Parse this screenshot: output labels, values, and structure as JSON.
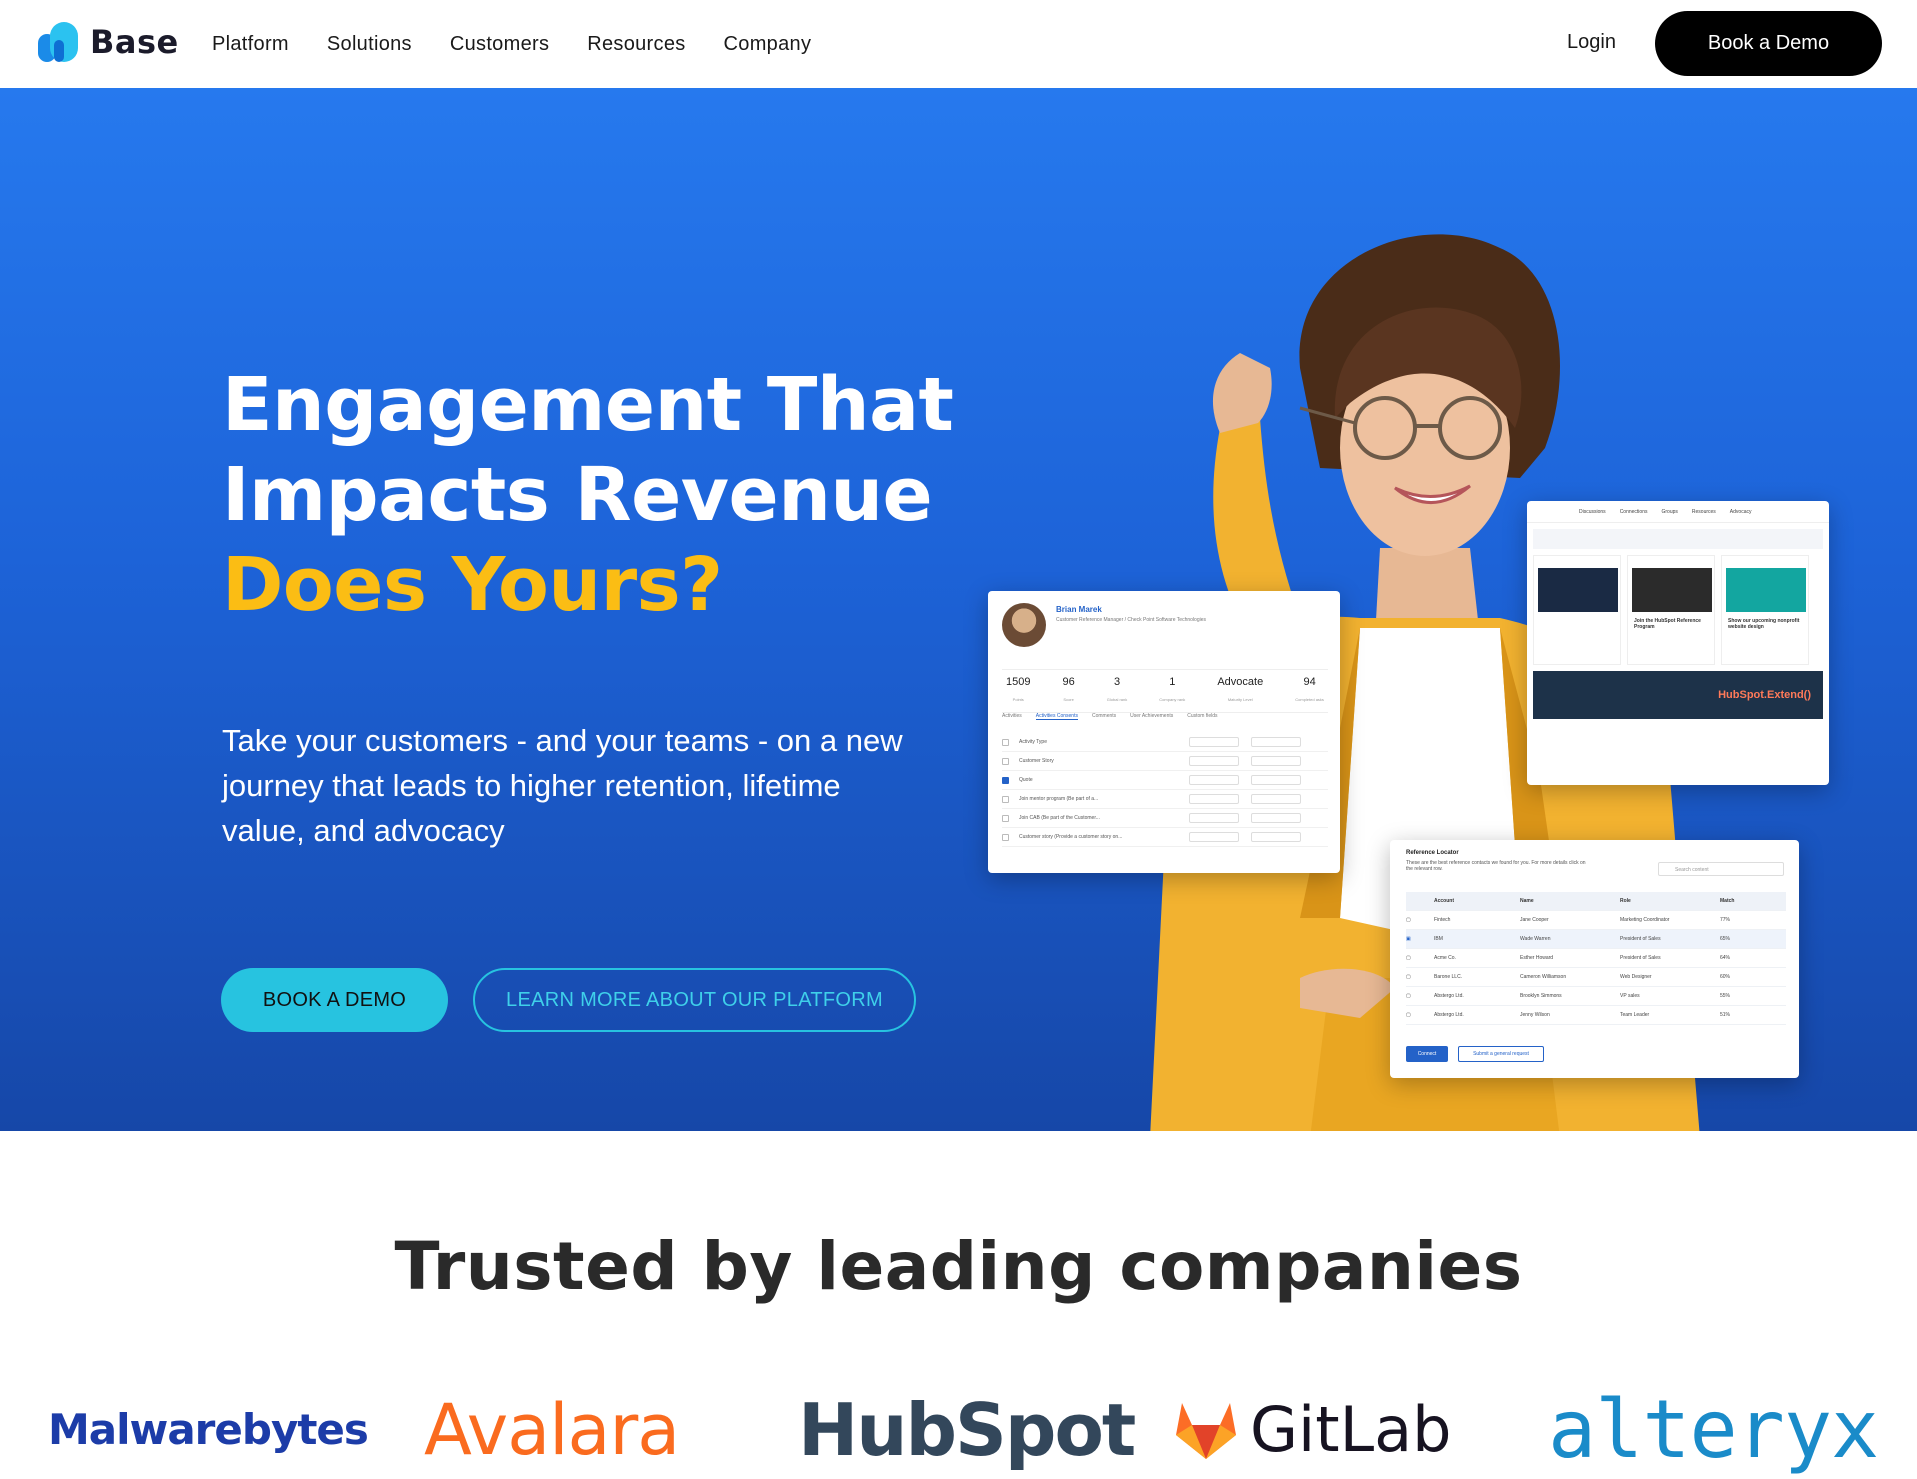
{
  "nav": {
    "brand": "Base",
    "menu": [
      "Platform",
      "Solutions",
      "Customers",
      "Resources",
      "Company"
    ],
    "login": "Login",
    "book_demo": "Book a Demo"
  },
  "hero": {
    "title_line1": "Engagement That",
    "title_line2": "Impacts Revenue",
    "title_accent": "Does Yours?",
    "subtitle": "Take your customers - and your teams - on a new journey that leads to higher retention, lifetime value, and advocacy",
    "cta_primary": "BOOK A DEMO",
    "cta_secondary": "LEARN MORE ABOUT OUR PLATFORM",
    "colors": {
      "accent": "#fbbd14",
      "cta": "#27c3e0",
      "background": "#1d63d8"
    }
  },
  "profile_card": {
    "name": "Brian Marek",
    "role": "Customer Reference Manager / Check Point Software Technologies",
    "stats": [
      {
        "value": "1509",
        "label": "Points"
      },
      {
        "value": "96",
        "label": "Score"
      },
      {
        "value": "3",
        "label": "Global rank"
      },
      {
        "value": "1",
        "label": "Company rank"
      },
      {
        "value": "Advocate",
        "label": "Maturity Level"
      },
      {
        "value": "94",
        "label": "Completed asks"
      }
    ],
    "tabs": [
      "Activities",
      "Activities Consents",
      "Comments",
      "User Achievements",
      "Custom fields"
    ],
    "rows": [
      {
        "label": "Activity Type",
        "checked": false
      },
      {
        "label": "Customer Story",
        "checked": false
      },
      {
        "label": "Quote",
        "checked": true
      },
      {
        "label": "Join mentor program (Be part of a...",
        "checked": false
      },
      {
        "label": "Join CAB (Be part of the Customer...",
        "checked": false
      },
      {
        "label": "Customer story (Provide a customer story on...",
        "checked": false
      }
    ]
  },
  "community_card": {
    "menu": [
      "Discussions",
      "Connections",
      "Groups",
      "Resources",
      "Advocacy"
    ],
    "tiles": [
      {
        "title": "",
        "color": "#1a2a44"
      },
      {
        "title": "Join the HubSpot Reference Program",
        "color": "#2b2b2b"
      },
      {
        "title": "Show our upcoming nonprofit website design",
        "color": "#13a6a0"
      }
    ],
    "extend_label": "HubSpot.Extend()"
  },
  "locator_card": {
    "title": "Reference Locator",
    "description": "These are the best reference contacts we found for you. For more details click on the relevant row.",
    "search_placeholder": "Search content",
    "columns": [
      "Account",
      "Name",
      "Role",
      "Match"
    ],
    "rows": [
      {
        "account": "Fintech",
        "name": "Jane Cooper",
        "role": "Marketing Coordinator",
        "match": "77%"
      },
      {
        "account": "IBM",
        "name": "Wade Warren",
        "role": "President of Sales",
        "match": "65%"
      },
      {
        "account": "Acme Co.",
        "name": "Esther Howard",
        "role": "President of Sales",
        "match": "64%"
      },
      {
        "account": "Barone LLC.",
        "name": "Cameron Williamson",
        "role": "Web Designer",
        "match": "60%"
      },
      {
        "account": "Abstergo Ltd.",
        "name": "Brooklyn Simmons",
        "role": "VP sales",
        "match": "55%"
      },
      {
        "account": "Abstergo Ltd.",
        "name": "Jenny Wilson",
        "role": "Team Leader",
        "match": "51%"
      }
    ],
    "connect": "Connect",
    "general_request": "Submit a general request"
  },
  "trusted": {
    "title": "Trusted by leading companies",
    "logos": [
      {
        "name": "Malwarebytes",
        "color": "#1c3ca8"
      },
      {
        "name": "Avalara",
        "color": "#fa6b1f"
      },
      {
        "name": "HubSpot",
        "color": "#33475b"
      },
      {
        "name": "GitLab",
        "color": "#171321"
      },
      {
        "name": "alteryx",
        "color": "#1a8bc9"
      }
    ]
  }
}
